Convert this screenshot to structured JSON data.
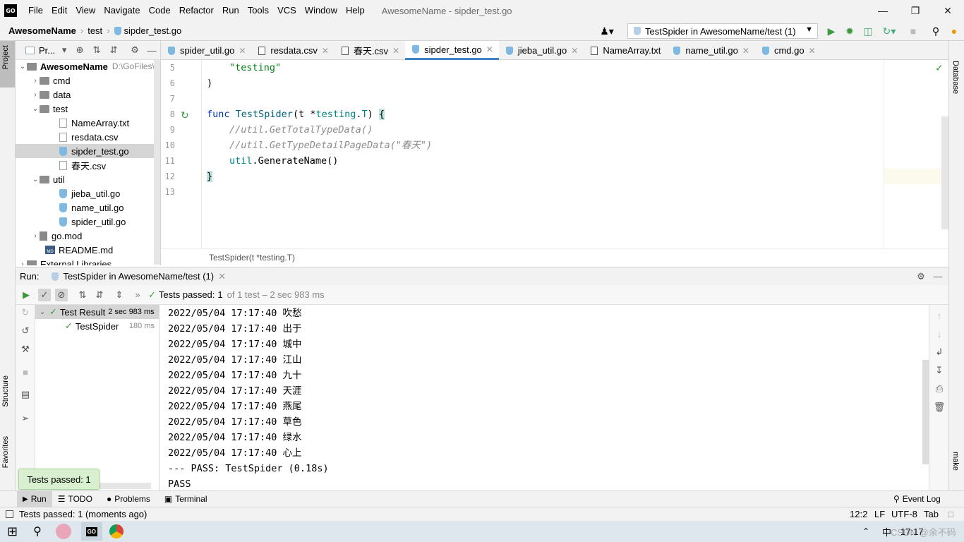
{
  "titlebar": {
    "menu": [
      "File",
      "Edit",
      "View",
      "Navigate",
      "Code",
      "Refactor",
      "Run",
      "Tools",
      "VCS",
      "Window",
      "Help"
    ],
    "window_title": "AwesomeName - sipder_test.go",
    "logo": "GO"
  },
  "navbar": {
    "project": "AwesomeName",
    "folder": "test",
    "file": "sipder_test.go",
    "run_config": "TestSpider in AwesomeName/test (1)"
  },
  "project_panel": {
    "header": "Pr...",
    "tree": [
      {
        "label": "AwesomeName",
        "extra": "D:\\GoFiles\\",
        "kind": "root"
      },
      {
        "label": "cmd",
        "kind": "folder"
      },
      {
        "label": "data",
        "kind": "folder"
      },
      {
        "label": "test",
        "kind": "folder"
      },
      {
        "label": "NameArray.txt",
        "kind": "file"
      },
      {
        "label": "resdata.csv",
        "kind": "file"
      },
      {
        "label": "sipder_test.go",
        "kind": "go"
      },
      {
        "label": "春天.csv",
        "kind": "file"
      },
      {
        "label": "util",
        "kind": "folder"
      },
      {
        "label": "jieba_util.go",
        "kind": "go"
      },
      {
        "label": "name_util.go",
        "kind": "go"
      },
      {
        "label": "spider_util.go",
        "kind": "go"
      },
      {
        "label": "go.mod",
        "kind": "mod"
      },
      {
        "label": "README.md",
        "kind": "md"
      },
      {
        "label": "External Libraries",
        "kind": "folder"
      }
    ]
  },
  "left_stripe": {
    "project": "Project",
    "structure": "Structure",
    "favorites": "Favorites"
  },
  "right_stripe": {
    "database": "Database",
    "make": "make"
  },
  "editor_tabs": [
    "spider_util.go",
    "resdata.csv",
    "春天.csv",
    "sipder_test.go",
    "jieba_util.go",
    "NameArray.txt",
    "name_util.go",
    "cmd.go"
  ],
  "editor": {
    "line_numbers": [
      "5",
      "6",
      "7",
      "8",
      "9",
      "10",
      "11",
      "12",
      "13"
    ],
    "breadcrumb": "TestSpider(t *testing.T)"
  },
  "run_panel": {
    "label": "Run:",
    "tab": "TestSpider in AwesomeName/test (1)",
    "status_passed": "Tests passed:",
    "status_count": "1",
    "status_rest": "of 1 test – 2 sec 983 ms",
    "test_result": "Test Result",
    "test_result_time": "2 sec 983 ms",
    "test_name": "TestSpider",
    "test_time": "180 ms",
    "output": [
      "2022/05/04 17:17:40 吹愁",
      "2022/05/04 17:17:40 出于",
      "2022/05/04 17:17:40 城中",
      "2022/05/04 17:17:40 江山",
      "2022/05/04 17:17:40 九十",
      "2022/05/04 17:17:40 天涯",
      "2022/05/04 17:17:40 燕尾",
      "2022/05/04 17:17:40 草色",
      "2022/05/04 17:17:40 绿水",
      "2022/05/04 17:17:40 心上",
      "--- PASS: TestSpider (0.18s)",
      "PASS"
    ]
  },
  "tooltip": "Tests passed: 1",
  "bottom_tools": {
    "run": "Run",
    "todo": "TODO",
    "problems": "Problems",
    "terminal": "Terminal",
    "event_log": "Event Log"
  },
  "status": {
    "message": "Tests passed: 1 (moments ago)",
    "position": "12:2",
    "line_sep": "LF",
    "encoding": "UTF-8",
    "indent": "Tab"
  },
  "taskbar": {
    "ime": "中",
    "time": "17:17",
    "watermark": "CSDN @余不码"
  }
}
